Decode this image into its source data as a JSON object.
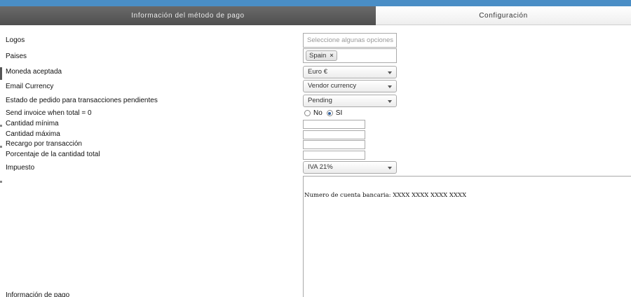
{
  "tabs": {
    "payment_info": "Información del método de pago",
    "configuration": "Configuración"
  },
  "form": {
    "logos": {
      "label": "Logos",
      "placeholder": "Seleccione algunas opciones"
    },
    "countries": {
      "label": "Paises",
      "selected": [
        "Spain"
      ],
      "remove_glyph": "×"
    },
    "currency": {
      "label": "Moneda aceptada",
      "value": "Euro €"
    },
    "email_currency": {
      "label": "Email Currency",
      "value": "Vendor currency"
    },
    "pending_status": {
      "label": "Estado de pedido para transacciones pendientes",
      "value": "Pending"
    },
    "send_invoice": {
      "label": "Send invoice when total = 0",
      "option_no": "No",
      "option_yes": "SI",
      "selected": "SI"
    },
    "min_amount": {
      "label": "Cantidad mínima",
      "value": ""
    },
    "max_amount": {
      "label": "Cantidad máxima",
      "value": ""
    },
    "fee_per_transaction": {
      "label": "Recargo por transacción",
      "value": ""
    },
    "fee_percentage": {
      "label": "Porcentaje de la cantidad total",
      "value": ""
    },
    "tax": {
      "label": "Impuesto",
      "value": "IVA 21%"
    },
    "payment_info": {
      "label": "Información de pago",
      "value": "Numero de cuenta bancaria: XXXX XXXX XXXX XXXX"
    }
  },
  "colors": {
    "top_bar": "#4a8ec6",
    "active_tab": "#5a5a5a"
  }
}
